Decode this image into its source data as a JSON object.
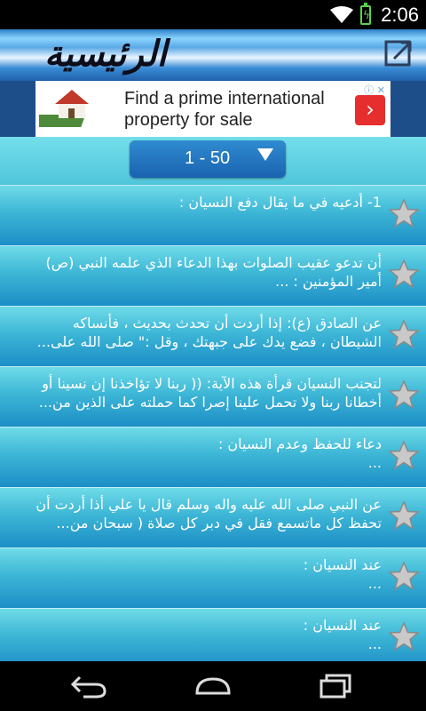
{
  "status": {
    "time": "2:06"
  },
  "titlebar": {
    "title": "الرئيسية",
    "share_icon": "share-icon"
  },
  "ad": {
    "text_line1": "Find a prime international",
    "text_line2": "property for sale",
    "arrow": "›"
  },
  "selector": {
    "value": "1 - 50"
  },
  "items": [
    {
      "text": "1- أدعيه في ما يقال دفع النسيان :"
    },
    {
      "text": "أن تدعو عقيب الصلوات بهذا الدعاء الذي علمه النبي (ص)\nأمير المؤمنين : ..."
    },
    {
      "text": "عن الصادق (ع): إذا أردت أن تحدث بحديث ، فأنساكه\nالشيطان ، فضع يدك على جبهتك ، وقل :\" صلى الله على..."
    },
    {
      "text": "لتجنب النسيان قرأة هذه الآية: (( ربنا لا تؤاخذنا إن نسينا أو\nأخطانا ربنا ولا تحمل علينا إصرا كما حملته على الذين من..."
    },
    {
      "text": "دعاء للحفظ وعدم النسيان :\n..."
    },
    {
      "text": "عن النبي صلى الله عليه واله وسلم قال يا علي أذا أردت أن\nتحفظ كل ماتسمع فقل في دبر كل صلاة ( سبحان من..."
    },
    {
      "text": "عند النسيان :\n..."
    },
    {
      "text": "عند النسيان :\n..."
    }
  ]
}
